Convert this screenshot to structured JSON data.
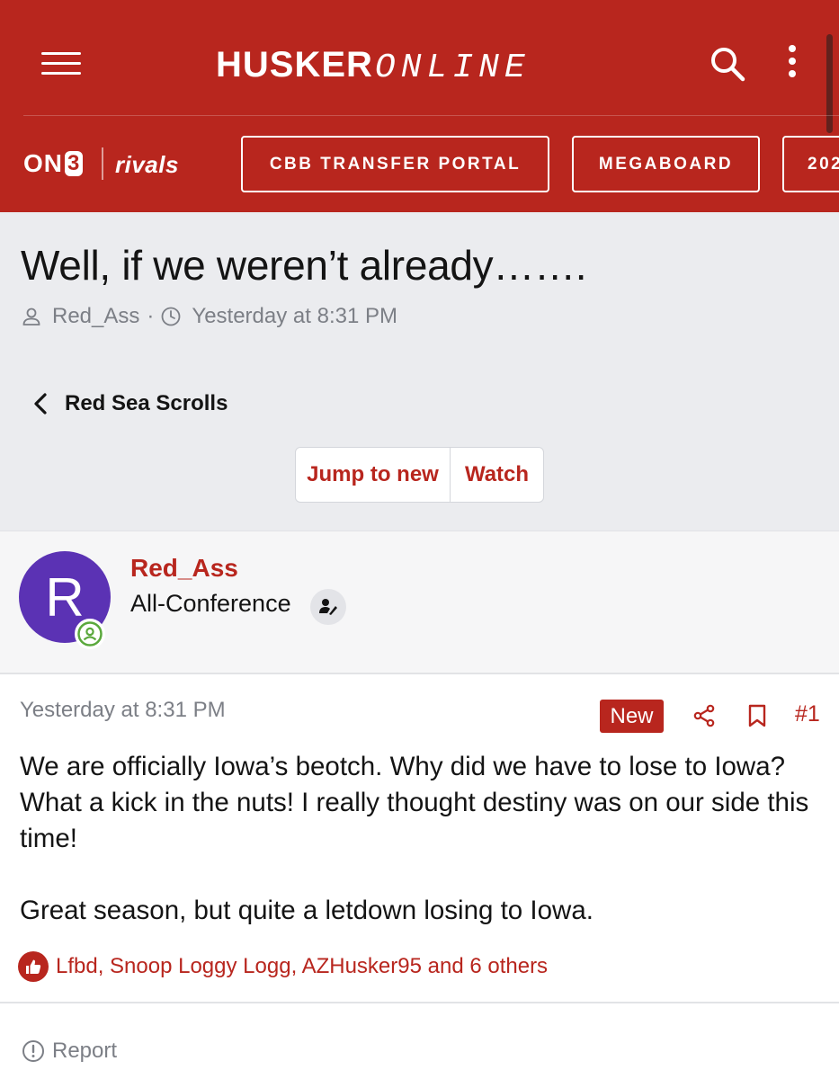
{
  "header": {
    "brand_bold": "HUSKER",
    "brand_light": "ONLINE",
    "on3_text": "ON",
    "on3_num": "3",
    "rivals_text": "rivals",
    "nav_buttons": [
      "CBB TRANSFER PORTAL",
      "MEGABOARD",
      "202"
    ],
    "colors": {
      "brand_red": "#b8261e"
    }
  },
  "thread": {
    "title": "Well, if we weren’t already…….",
    "author": "Red_Ass",
    "separator": "·",
    "date": "Yesterday at 8:31 PM",
    "forum_back_label": "Red Sea Scrolls",
    "jump_label": "Jump to new",
    "watch_label": "Watch"
  },
  "post": {
    "avatar_letter": "R",
    "username": "Red_Ass",
    "user_title": "All-Conference",
    "date": "Yesterday at 8:31 PM",
    "new_badge": "New",
    "number": "#1",
    "paragraphs": [
      "We are officially Iowa’s beotch. Why did we have to lose to Iowa? What a kick in the nuts! I really thought destiny was on our side this time!",
      "Great season, but quite a letdown losing to Iowa."
    ],
    "reactions_text": "Lfbd, Snoop Loggy Logg, AZHusker95 and 6 others",
    "report_label": "Report",
    "icons": [
      "menu-icon",
      "search-icon",
      "more-vertical-icon",
      "user-icon",
      "clock-icon",
      "chevron-left-icon",
      "online-status-icon",
      "role-icon",
      "share-icon",
      "bookmark-icon",
      "like-icon",
      "alert-circle-icon"
    ]
  }
}
